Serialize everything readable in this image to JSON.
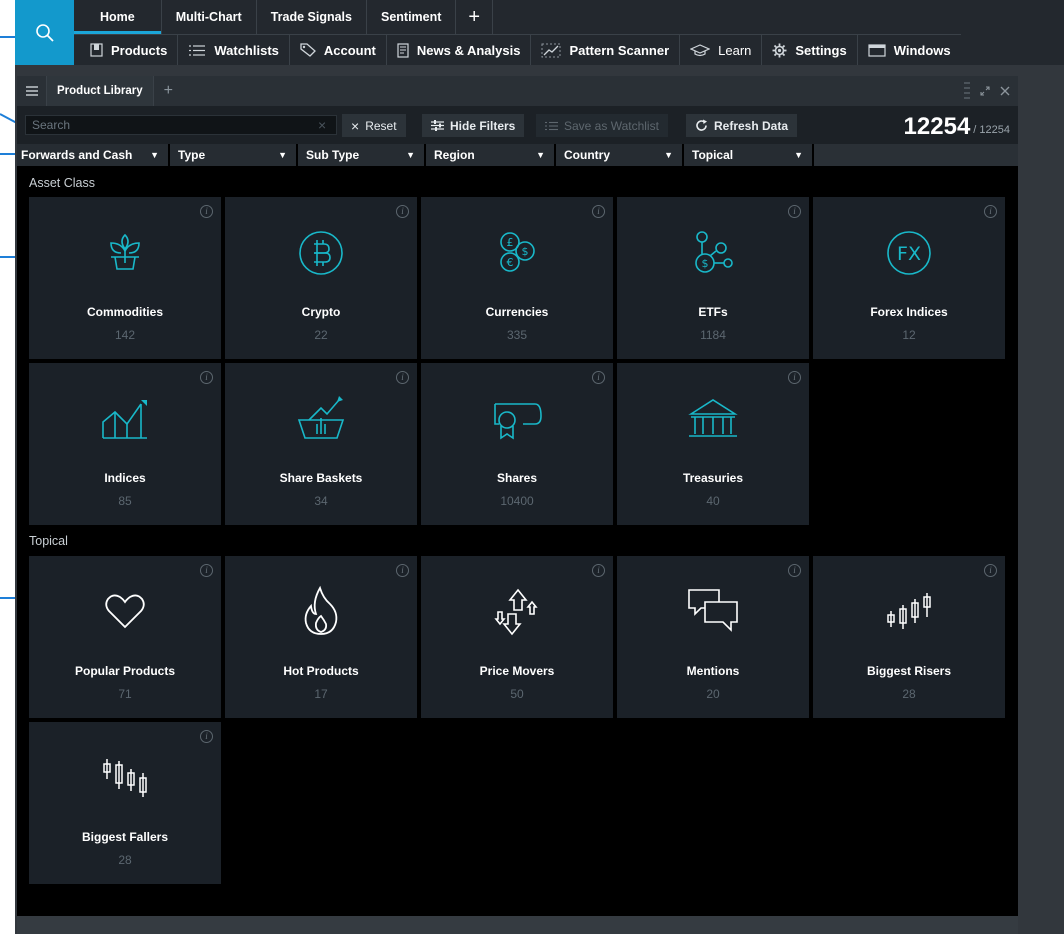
{
  "topbar": {
    "tabs": [
      {
        "label": "Home"
      },
      {
        "label": "Multi-Chart"
      },
      {
        "label": "Trade Signals"
      },
      {
        "label": "Sentiment"
      }
    ],
    "add_tab": "+",
    "menu": [
      {
        "label": "Products",
        "icon": "products-icon"
      },
      {
        "label": "Watchlists",
        "icon": "list-icon"
      },
      {
        "label": "Account",
        "icon": "tag-icon"
      },
      {
        "label": "News & Analysis",
        "icon": "document-icon"
      },
      {
        "label": "Pattern Scanner",
        "icon": "pattern-icon"
      },
      {
        "label": "Learn",
        "icon": "graduation-cap-icon"
      },
      {
        "label": "Settings",
        "icon": "gear-icon"
      },
      {
        "label": "Windows",
        "icon": "window-icon"
      }
    ]
  },
  "panel": {
    "tab": "Product Library",
    "add": "+"
  },
  "filters": {
    "search_placeholder": "Search",
    "reset": "Reset",
    "hide_filters": "Hide Filters",
    "save_watchlist": "Save as Watchlist",
    "refresh": "Refresh Data",
    "count_shown": "12254",
    "count_total": "/ 12254"
  },
  "dropdowns": [
    {
      "label": "Forwards and Cash"
    },
    {
      "label": "Type"
    },
    {
      "label": "Sub Type"
    },
    {
      "label": "Region"
    },
    {
      "label": "Country"
    },
    {
      "label": "Topical"
    }
  ],
  "asset_class": {
    "title": "Asset Class",
    "tiles": [
      {
        "label": "Commodities",
        "count": "142",
        "icon": "plant-icon"
      },
      {
        "label": "Crypto",
        "count": "22",
        "icon": "bitcoin-icon"
      },
      {
        "label": "Currencies",
        "count": "335",
        "icon": "currency-coins-icon"
      },
      {
        "label": "ETFs",
        "count": "1184",
        "icon": "etf-nodes-icon"
      },
      {
        "label": "Forex Indices",
        "count": "12",
        "icon": "fx-icon"
      },
      {
        "label": "Indices",
        "count": "85",
        "icon": "index-chart-icon"
      },
      {
        "label": "Share Baskets",
        "count": "34",
        "icon": "basket-icon"
      },
      {
        "label": "Shares",
        "count": "10400",
        "icon": "certificate-icon"
      },
      {
        "label": "Treasuries",
        "count": "40",
        "icon": "bank-icon"
      }
    ]
  },
  "topical": {
    "title": "Topical",
    "tiles": [
      {
        "label": "Popular Products",
        "count": "71",
        "icon": "heart-icon"
      },
      {
        "label": "Hot Products",
        "count": "17",
        "icon": "flame-icon"
      },
      {
        "label": "Price Movers",
        "count": "50",
        "icon": "up-down-arrows-icon"
      },
      {
        "label": "Mentions",
        "count": "20",
        "icon": "speech-bubbles-icon"
      },
      {
        "label": "Biggest Risers",
        "count": "28",
        "icon": "candles-up-icon"
      },
      {
        "label": "Biggest Fallers",
        "count": "28",
        "icon": "candles-down-icon"
      }
    ]
  },
  "colors": {
    "accent": "#1ba6d9",
    "icon_teal": "#19b8c9",
    "search_tile": "#1399cc",
    "callout": "#1e7fd8"
  }
}
